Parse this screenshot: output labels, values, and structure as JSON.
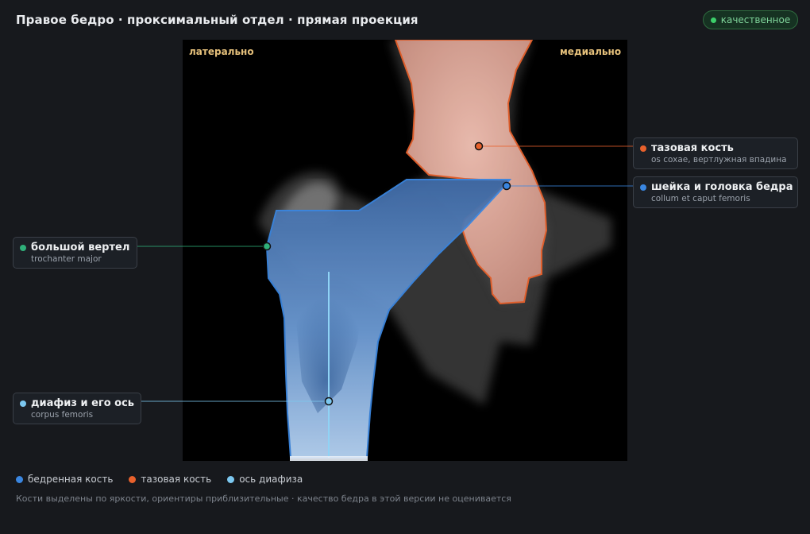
{
  "header": {
    "title": "Правое бедро · проксимальный отдел · прямая проекция",
    "badge": "качественное",
    "badge_color": "#3ccf6a"
  },
  "viewer": {
    "orientation_left": "латерально",
    "orientation_right": "медиально"
  },
  "labels": {
    "pelvis": {
      "main": "тазовая кость",
      "sub": "os coxae, вертлужная впадина",
      "color": "#e8612c"
    },
    "neck": {
      "main": "шейка и головка бедра",
      "sub": "collum et caput femoris",
      "color": "#3a86e0"
    },
    "trochanter": {
      "main": "большой вертел",
      "sub": "trochanter major",
      "color": "#2fb07a"
    },
    "shaft": {
      "main": "диафиз и его ось",
      "sub": "corpus femoris",
      "color": "#7cc8f0"
    }
  },
  "legend": [
    {
      "label": "бедренная кость",
      "color": "#3a86e0"
    },
    {
      "label": "тазовая кость",
      "color": "#e8612c"
    },
    {
      "label": "ось диафиза",
      "color": "#7cc8f0"
    }
  ],
  "footnote": "Кости выделены по яркости, ориентиры приблизительные · качество бедра в этой версии не оценивается"
}
